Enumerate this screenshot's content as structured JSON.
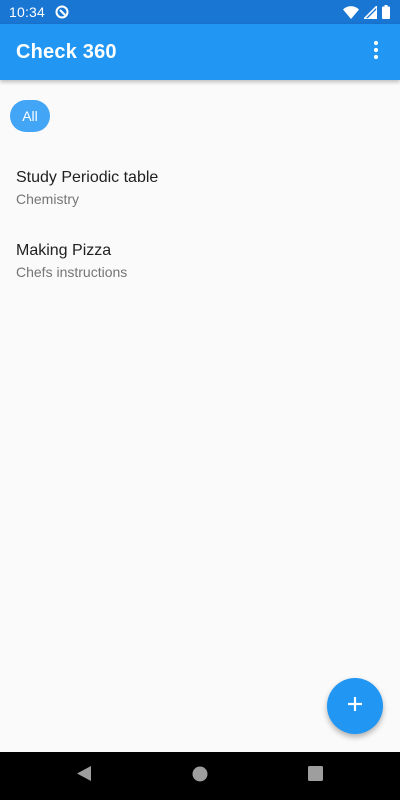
{
  "status_bar": {
    "time": "10:34",
    "icons": [
      "app-notification-icon",
      "wifi-icon",
      "signal-icon",
      "battery-icon"
    ]
  },
  "app_bar": {
    "title": "Check 360",
    "menu_icon": "more-vert-icon",
    "color": "#2196f3"
  },
  "filters": {
    "chips": [
      {
        "label": "All",
        "selected": true
      }
    ]
  },
  "checklists": [
    {
      "title": "Study Periodic table",
      "subtitle": "Chemistry"
    },
    {
      "title": "Making Pizza",
      "subtitle": "Chefs instructions"
    }
  ],
  "fab": {
    "icon": "plus-icon",
    "color": "#2196f3"
  },
  "nav_bar": {
    "buttons": [
      "back-icon",
      "home-icon",
      "recents-icon"
    ]
  }
}
